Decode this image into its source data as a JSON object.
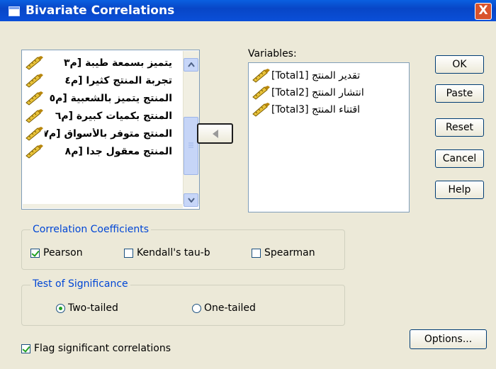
{
  "window": {
    "title": "Bivariate Correlations",
    "close_glyph": "X"
  },
  "source_list": {
    "items": [
      {
        "label": "يتميز بسمعة طيبة [م٣",
        "icon": "ruler-pencil-icon"
      },
      {
        "label": "تجربة المنتج كثيرا [م٤",
        "icon": "ruler-pencil-icon"
      },
      {
        "label": "المنتج يتميز بالشعبية [م٥",
        "icon": "ruler-pencil-icon"
      },
      {
        "label": "المنتج بكميات كبيرة [م٦",
        "icon": "ruler-pencil-icon"
      },
      {
        "label": "المنتج متوفر بالأسواق [م٧",
        "icon": "ruler-pencil-icon"
      },
      {
        "label": "المنتج معقول جدا [م٨",
        "icon": "ruler-pencil-icon"
      }
    ]
  },
  "variables": {
    "label": "Variables:",
    "items": [
      {
        "label": "تقدير المنتج [Total1]",
        "icon": "ruler-pencil-icon"
      },
      {
        "label": "انتشار المنتج [Total2]",
        "icon": "ruler-pencil-icon"
      },
      {
        "label": "اقتناء المنتج [Total3]",
        "icon": "ruler-pencil-icon"
      }
    ]
  },
  "buttons": {
    "ok": "OK",
    "paste": "Paste",
    "reset": "Reset",
    "cancel": "Cancel",
    "help": "Help",
    "options": "Options..."
  },
  "correlation": {
    "legend": "Correlation Coefficients",
    "pearson": {
      "label": "Pearson",
      "checked": true
    },
    "kendall": {
      "label": "Kendall's tau-b",
      "checked": false
    },
    "spearman": {
      "label": "Spearman",
      "checked": false
    }
  },
  "significance": {
    "legend": "Test of Significance",
    "two_tailed": {
      "label": "Two-tailed",
      "selected": true
    },
    "one_tailed": {
      "label": "One-tailed",
      "selected": false
    }
  },
  "flag": {
    "label": "Flag significant correlations",
    "checked": true
  }
}
